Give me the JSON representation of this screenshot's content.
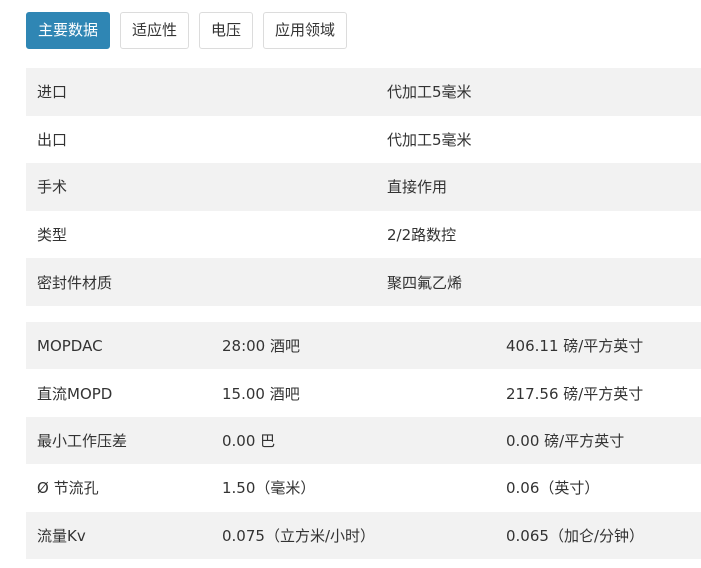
{
  "tabs": [
    {
      "label": "主要数据",
      "active": true
    },
    {
      "label": "适应性",
      "active": false
    },
    {
      "label": "电压",
      "active": false
    },
    {
      "label": "应用领域",
      "active": false
    }
  ],
  "main_table": {
    "rows": [
      {
        "label": "进口",
        "value": "代加工5毫米"
      },
      {
        "label": "出口",
        "value": "代加工5毫米"
      },
      {
        "label": "手术",
        "value": "直接作用"
      },
      {
        "label": "类型",
        "value": "2/2路数控"
      },
      {
        "label": "密封件材质",
        "value": "聚四氟乙烯"
      }
    ]
  },
  "pressure_table": {
    "rows": [
      {
        "label": "MOPDAC",
        "metric": "28:00 酒吧",
        "imperial": "406.11 磅/平方英寸"
      },
      {
        "label": "直流MOPD",
        "metric": "15.00 酒吧",
        "imperial": "217.56 磅/平方英寸"
      },
      {
        "label": "最小工作压差",
        "metric": "0.00 巴",
        "imperial": "0.00 磅/平方英寸"
      },
      {
        "label": "Ø 节流孔",
        "metric": "1.50（毫米）",
        "imperial": "0.06（英寸）"
      },
      {
        "label": "流量Kv",
        "metric": "0.075（立方米/小时）",
        "imperial": "0.065（加仑/分钟）"
      }
    ]
  },
  "colors": {
    "active_tab": "#2f86b4",
    "row_shade": "#f2f2f2",
    "text": "#333333"
  }
}
